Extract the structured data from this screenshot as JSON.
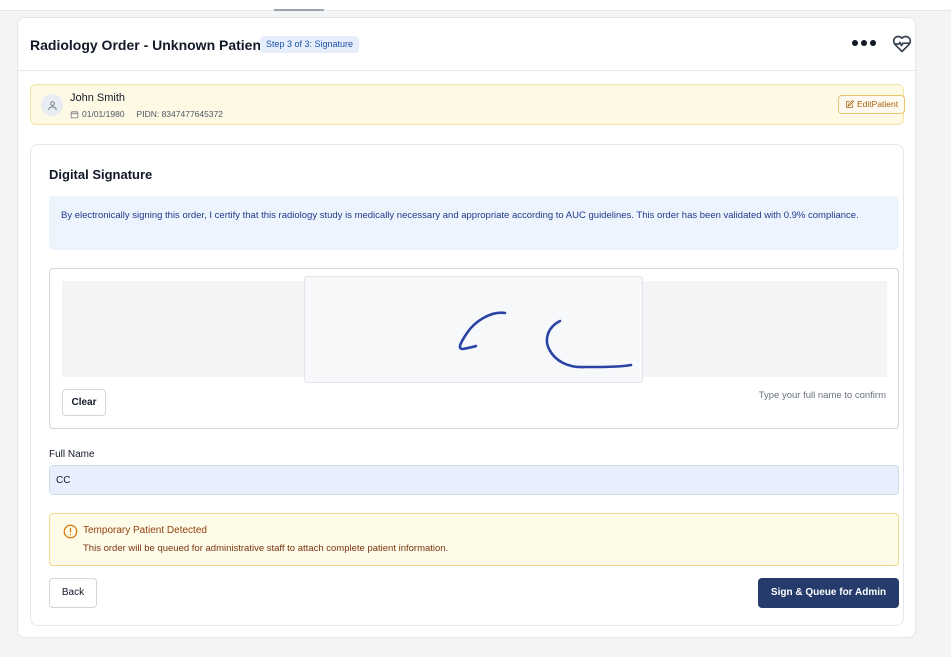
{
  "header": {
    "title": "Radiology Order - Unknown Patient",
    "step_badge": "Step 3 of 3: Signature",
    "more_icon": "more-horizontal-icon",
    "health_icon": "heart-pulse-icon"
  },
  "patient": {
    "name": "John Smith",
    "dob": "01/01/1980",
    "pidn": "PIDN: 8347477645372",
    "edit_label": "EditPatient"
  },
  "signature": {
    "heading": "Digital Signature",
    "notice": "By electronically signing this order, I certify that this radiology study is medically necessary and appropriate according to AUC guidelines. This order has been validated with 0.9% compliance.",
    "clear_label": "Clear",
    "hint": "Type your full name to confirm"
  },
  "full_name": {
    "label": "Full Name",
    "value": "CC"
  },
  "warning": {
    "title": "Temporary Patient Detected",
    "text": "This order will be queued for administrative staff to attach complete patient information."
  },
  "actions": {
    "back_label": "Back",
    "submit_label": "Sign & Queue for Admin"
  },
  "colors": {
    "primary": "#243b6b",
    "ink": "#2a44a6",
    "warning_bg": "#fefbe8",
    "notice_bg": "#eef4fd"
  }
}
